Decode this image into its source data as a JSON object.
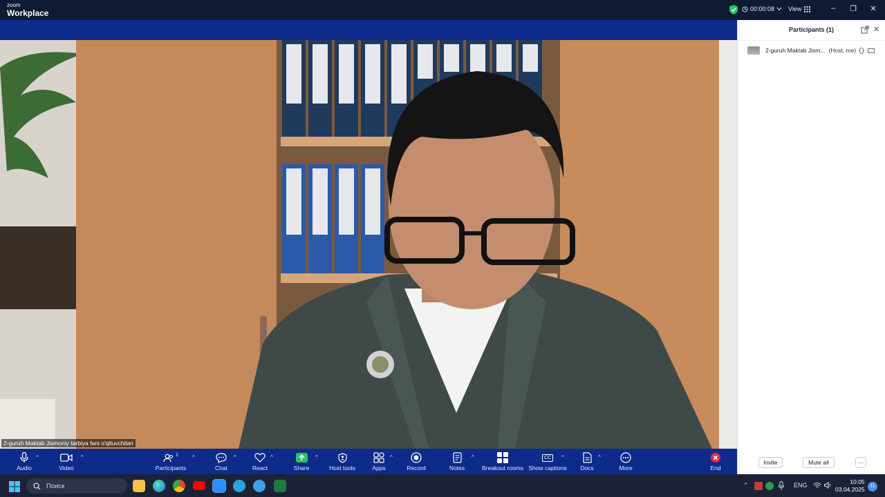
{
  "app": {
    "brand_small": "zoom",
    "brand_large": "Workplace"
  },
  "titlebar": {
    "timer": "00:00:08",
    "view_label": "View",
    "minimize": "–",
    "restore": "❐",
    "close": "✕"
  },
  "video": {
    "name_tag": "2-guruh Maktab Jismoniy tarbiya fani o'qituvchilari"
  },
  "participants": {
    "title": "Participants (1)",
    "close_glyph": "✕",
    "list": [
      {
        "name": "2-guruh Maktab Jism...",
        "role": "(Host, me)"
      }
    ],
    "invite_label": "Invite",
    "mute_all_label": "Mute all",
    "more_glyph": "···"
  },
  "toolbar": {
    "audio": "Audio",
    "video": "Video",
    "participants": "Participants",
    "participants_count": "1",
    "chat": "Chat",
    "react": "React",
    "share": "Share",
    "host_tools": "Host tools",
    "apps": "Apps",
    "record": "Record",
    "notes": "Notes",
    "breakout": "Breakout rooms",
    "captions": "Show captions",
    "captions_icon": "CC",
    "docs": "Docs",
    "more": "More",
    "end": "End"
  },
  "taskbar": {
    "search_placeholder": "Поиск",
    "language": "ENG",
    "time": "10:05",
    "date": "03.04.2025",
    "notification_count": "11",
    "tray_caret": "⌃"
  },
  "colors": {
    "toolbar_bg": "#0e2a8a",
    "titlebar_bg": "#0f1a33",
    "end_red": "#e02f44",
    "share_green": "#25c26b"
  },
  "icons": [
    "mic-icon",
    "camera-icon",
    "participants-icon",
    "chat-icon",
    "heart-icon",
    "share-arrow-icon",
    "shield-icon",
    "apps-icon",
    "record-icon",
    "notes-icon",
    "breakout-grid-icon",
    "cc-icon",
    "docs-icon",
    "more-dots-icon",
    "end-icon"
  ]
}
